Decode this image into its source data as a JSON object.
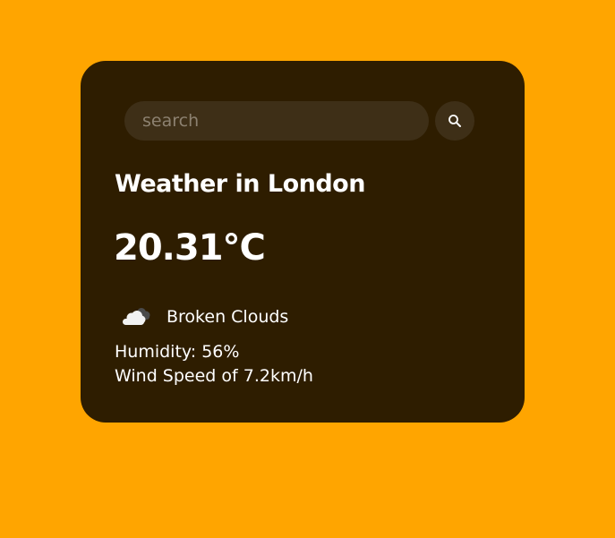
{
  "search": {
    "placeholder": "search",
    "value": "",
    "button_icon": "search-icon"
  },
  "weather": {
    "title": "Weather in London",
    "temperature": "20.31°C",
    "condition_icon": "broken-clouds-icon",
    "condition": "Broken Clouds",
    "humidity": "Humidity: 56%",
    "wind": "Wind Speed of 7.2km/h"
  },
  "colors": {
    "page_background": "#FFA500",
    "card_background": "#2E1D00",
    "input_background": "#3E2F17",
    "text": "#FFFFFF"
  }
}
